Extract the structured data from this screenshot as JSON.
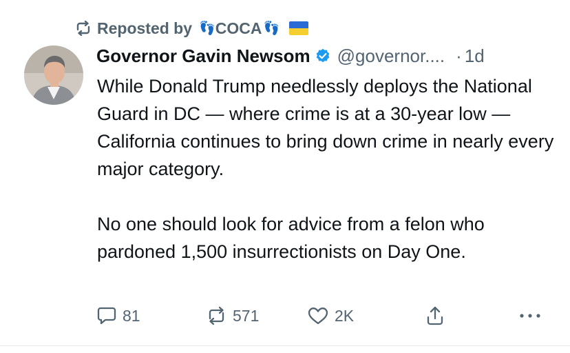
{
  "repost_banner": {
    "prefix": "Reposted by",
    "reposter_name": "COCA",
    "feet_glyph": "👣",
    "flag_icon": "ukraine-flag-icon"
  },
  "post": {
    "display_name": "Governor Gavin Newsom",
    "verified": true,
    "handle": "@governor....",
    "separator": "·",
    "time": "1d",
    "paragraphs": [
      "While Donald Trump needlessly deploys the National Guard in DC — where crime is at a 30-year low — California continues to bring down crime in nearly every major category.",
      "No one should look for advice from a felon who pardoned 1,500 insurrectionists on Day One."
    ]
  },
  "actions": {
    "replies": "81",
    "reposts": "571",
    "likes": "2K",
    "share_icon": "share-icon",
    "more_icon": "more-icon"
  },
  "colors": {
    "text": "#0f1419",
    "muted": "#536471",
    "verified": "#1d9bf0",
    "flag_blue": "#2a6bd6",
    "flag_yellow": "#f4cf2f"
  }
}
